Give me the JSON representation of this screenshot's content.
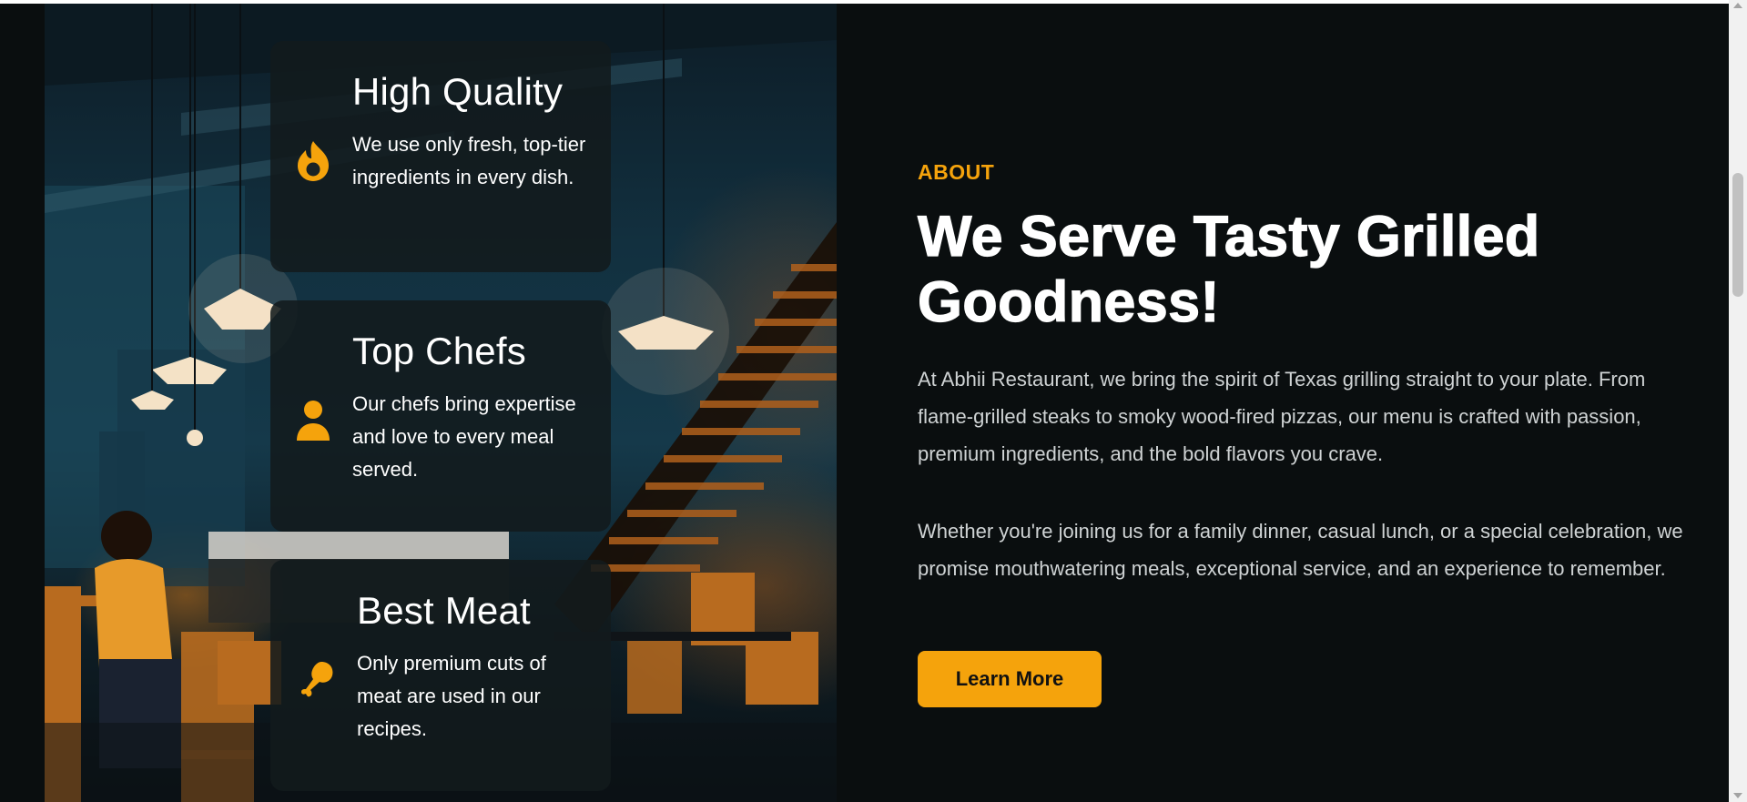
{
  "features": [
    {
      "title": "High Quality",
      "text": "We use only fresh, top-tier ingredients in every dish.",
      "icon": "flame-icon"
    },
    {
      "title": "Top Chefs",
      "text": "Our chefs bring expertise and love to every meal served.",
      "icon": "chef-icon"
    },
    {
      "title": "Best Meat",
      "text": "Only premium cuts of meat are used in our recipes.",
      "icon": "drumstick-icon"
    }
  ],
  "about": {
    "label": "ABOUT",
    "headline": "We Serve Tasty Grilled Goodness!",
    "paragraph1": "At Abhii Restaurant, we bring the spirit of Texas grilling straight to your plate. From flame-grilled steaks to smoky wood-fired pizzas, our menu is crafted with passion, premium ingredients, and the bold flavors you crave.",
    "paragraph2": "Whether you're joining us for a family dinner, casual lunch, or a special celebration, we promise mouthwatering meals, exceptional service, and an experience to remember.",
    "button_label": "Learn More"
  },
  "colors": {
    "accent": "#f5a30c",
    "background": "#0a0e0f",
    "card": "#121a1c",
    "text": "#ffffff",
    "muted_text": "#cfd3d4"
  }
}
